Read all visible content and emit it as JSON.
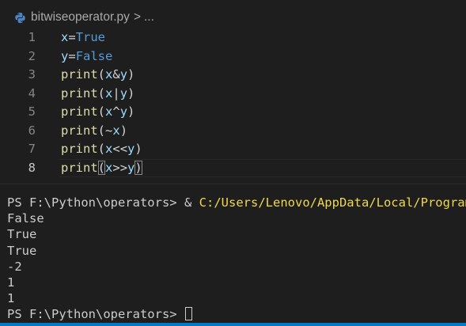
{
  "breadcrumb": {
    "file_icon": "python-icon",
    "file_name": "bitwiseoperator.py",
    "separator": ">",
    "more": "..."
  },
  "editor": {
    "current_line": 8,
    "lines": [
      {
        "number": "1",
        "text": "x=True"
      },
      {
        "number": "2",
        "text": "y=False"
      },
      {
        "number": "3",
        "text": "print(x&y)"
      },
      {
        "number": "4",
        "text": "print(x|y)"
      },
      {
        "number": "5",
        "text": "print(x^y)"
      },
      {
        "number": "6",
        "text": "print(~x)"
      },
      {
        "number": "7",
        "text": "print(x<<y)"
      },
      {
        "number": "8",
        "text": "print(x>>y)"
      }
    ]
  },
  "terminal": {
    "prompt": "PS F:\\Python\\operators>",
    "command_prefix": "&",
    "command_path": "C:/Users/Lenovo/AppData/Local/Programs/",
    "output": [
      "False",
      "True",
      "True",
      "-2",
      "1",
      "1"
    ]
  },
  "colors": {
    "background": "#1e1e1e",
    "keyword": "#569cd6",
    "variable": "#9cdcfe",
    "function": "#dcdcaa",
    "terminal_path": "#f0d84c",
    "status_bar": "#007acc"
  }
}
